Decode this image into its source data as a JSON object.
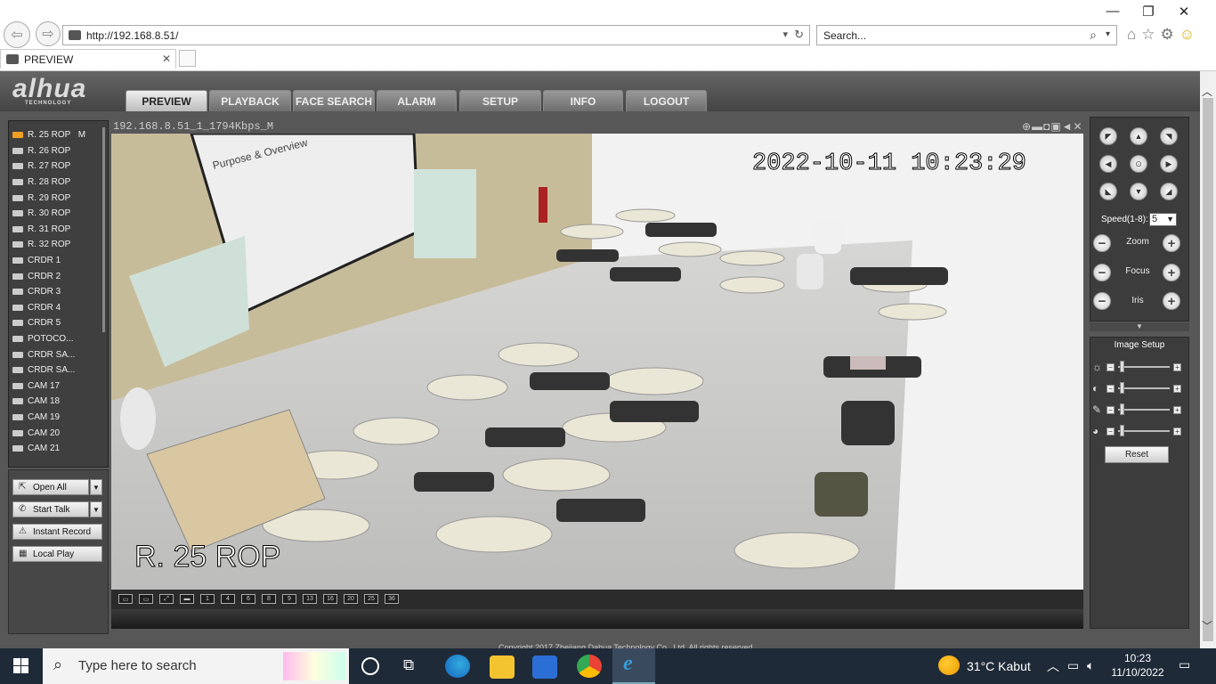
{
  "browser": {
    "url": "http://192.168.8.51/",
    "search_placeholder": "Search...",
    "tab_title": "PREVIEW",
    "window_controls": [
      "minimize-icon",
      "restore-icon",
      "close-icon"
    ]
  },
  "app": {
    "logo": "alhua",
    "logo_sub": "TECHNOLOGY",
    "nav": [
      {
        "label": "PREVIEW",
        "active": true
      },
      {
        "label": "PLAYBACK",
        "active": false
      },
      {
        "label": "FACE SEARCH",
        "active": false
      },
      {
        "label": "ALARM",
        "active": false
      },
      {
        "label": "SETUP",
        "active": false
      },
      {
        "label": "INFO",
        "active": false
      },
      {
        "label": "LOGOUT",
        "active": false
      }
    ],
    "cameras": [
      "R. 25 ROP",
      "R. 26 ROP",
      "R. 27 ROP",
      "R. 28 ROP",
      "R. 29 ROP",
      "R. 30 ROP",
      "R. 31 ROP",
      "R. 32 ROP",
      "CRDR 1",
      "CRDR 2",
      "CRDR 3",
      "CRDR 4",
      "CRDR 5",
      "POTOCO...",
      "CRDR SA...",
      "CRDR SA...",
      "CAM 17",
      "CAM 18",
      "CAM 19",
      "CAM 20",
      "CAM 21"
    ],
    "active_camera_marker": "M",
    "controls": {
      "open_all": "Open All",
      "start_talk": "Start Talk",
      "instant_record": "Instant Record",
      "local_play": "Local Play"
    },
    "video": {
      "title": "192.168.8.51_1_1794Kbps_M",
      "timestamp": "2022-10-11  10:23:29",
      "channel_label": "R. 25 ROP",
      "slide_title": "Purpose & Overview",
      "layout_buttons": [
        "▭",
        "▭",
        "⤢",
        "▬",
        "1",
        "4",
        "6",
        "8",
        "9",
        "13",
        "16",
        "20",
        "25",
        "36"
      ]
    },
    "ptz": {
      "speed_label": "Speed(1-8):",
      "speed_value": "5",
      "zoom": "Zoom",
      "focus": "Focus",
      "iris": "Iris"
    },
    "image_setup": {
      "title": "Image Setup",
      "rows": [
        "brightness-icon",
        "contrast-icon",
        "saturation-icon",
        "hue-icon"
      ],
      "reset": "Reset"
    },
    "footer_text": "Copyright 2017 Zhejiang Dahua Technology Co., Ltd. All rights reserved."
  },
  "taskbar": {
    "search_placeholder": "Type here to search",
    "weather": "31°C  Kabut",
    "time": "10:23",
    "date": "11/10/2022"
  },
  "colors": {
    "app_bg": "#575757",
    "taskbar_bg": "#1f2a38",
    "active_cam": "#f0a020"
  }
}
